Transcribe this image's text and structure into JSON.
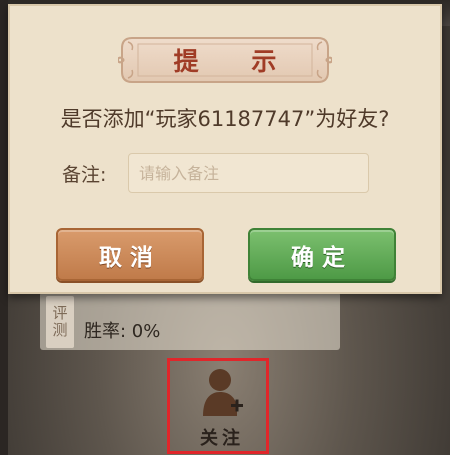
{
  "dialog": {
    "title": "提  示",
    "question": "是否添加“玩家61187747”为好友?",
    "remark_label": "备注:",
    "remark_placeholder": "请输入备注",
    "cancel_label": "取消",
    "confirm_label": "确定"
  },
  "background": {
    "tag_text": "评测",
    "win_rate": "胜率: 0%",
    "follow_label": "关注"
  },
  "colors": {
    "dialog_bg": "#ede1cb",
    "title_color": "#a03c26",
    "cancel_button": "#c98754",
    "confirm_button": "#5da653",
    "highlight_box": "#e0262a"
  },
  "icons": {
    "follow": "user-plus-icon"
  }
}
